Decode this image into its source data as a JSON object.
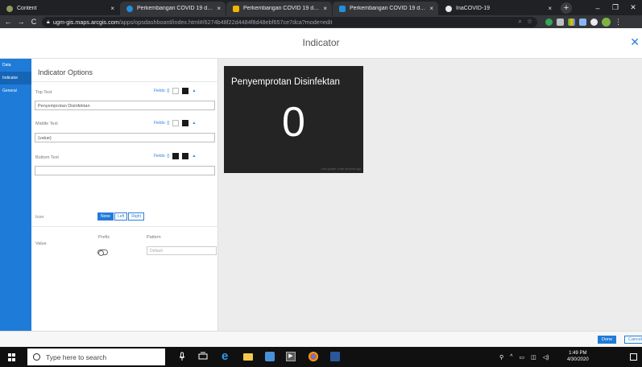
{
  "browser": {
    "tabs": [
      {
        "label": "Content",
        "favicon_color": "#8e9a5e"
      },
      {
        "label": "Perkembangan COVID 19 di In",
        "favicon_color": "#1f8fe0"
      },
      {
        "label": "Perkembangan COVID 19 di In",
        "favicon_color": "#f2b600"
      },
      {
        "label": "Perkembangan COVID 19 di In",
        "favicon_color": "#1f8fe0"
      },
      {
        "label": "InaCOVID-19",
        "favicon_color": "#9aa0a6"
      }
    ],
    "tab_close": "×",
    "new_tab": "+",
    "window_controls": {
      "minimize": "–",
      "maximize": "❐",
      "close": "✕"
    },
    "nav": {
      "back": "←",
      "forward": "→",
      "reload": "C"
    },
    "url_host": "ugm-gis.maps.arcgis.com",
    "url_path": "/apps/opsdashboard/index.html#/6274b48f22d4484f8d48ebf657ce7dca?mode=edit"
  },
  "app": {
    "title": "Indicator",
    "close": "✕",
    "nav_items": [
      "Data",
      "Indicator",
      "General"
    ],
    "panel_title": "Indicator Options",
    "fields_label": "Fields: {}",
    "top_text": {
      "label": "Top Text",
      "value": "Penyemprotan Disinfektan"
    },
    "middle_text": {
      "label": "Middle Text",
      "value": "{value}"
    },
    "bottom_text": {
      "label": "Bottom Text",
      "value": ""
    },
    "icon": {
      "label": "Icon",
      "options": [
        "None",
        "Left",
        "Right"
      ],
      "selected": "None"
    },
    "value": {
      "label": "Value",
      "prefix_label": "Prefix",
      "pattern_label": "Pattern",
      "pattern_placeholder": "Default",
      "prefix_on": false
    },
    "preview": {
      "top": "Penyemprotan Disinfektan",
      "middle": "0",
      "footnote": "Last update: a few seconds ago"
    },
    "footer": {
      "done": "Done",
      "cancel": "Cancel"
    }
  },
  "taskbar": {
    "search_placeholder": "Type here to search",
    "time": "1:49 PM",
    "date": "4/30/2020"
  }
}
